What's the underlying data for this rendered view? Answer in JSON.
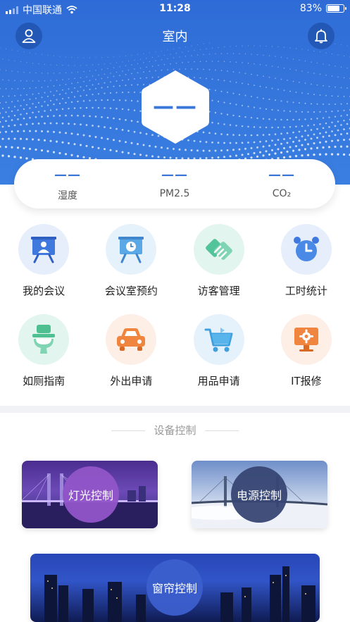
{
  "status_bar": {
    "carrier": "中国联通",
    "time": "11:28",
    "battery": "83%",
    "battery_level": 0.83
  },
  "header": {
    "title": "室内",
    "hex_value": "——"
  },
  "metrics": [
    {
      "value": "——",
      "label": "湿度"
    },
    {
      "value": "——",
      "label": "PM2.5"
    },
    {
      "value": "——",
      "label": "CO₂"
    }
  ],
  "grid": [
    {
      "label": "我的会议",
      "icon": "presentation-icon"
    },
    {
      "label": "会议室预约",
      "icon": "clock-board-icon"
    },
    {
      "label": "访客管理",
      "icon": "handshake-icon"
    },
    {
      "label": "工时统计",
      "icon": "alarm-clock-icon"
    },
    {
      "label": "如厕指南",
      "icon": "toilet-icon"
    },
    {
      "label": "外出申请",
      "icon": "car-icon"
    },
    {
      "label": "用品申请",
      "icon": "cart-icon"
    },
    {
      "label": "IT报修",
      "icon": "monitor-gear-icon"
    }
  ],
  "section_title": "设备控制",
  "controls": {
    "light": "灯光控制",
    "power": "电源控制",
    "curtain": "窗帘控制"
  }
}
